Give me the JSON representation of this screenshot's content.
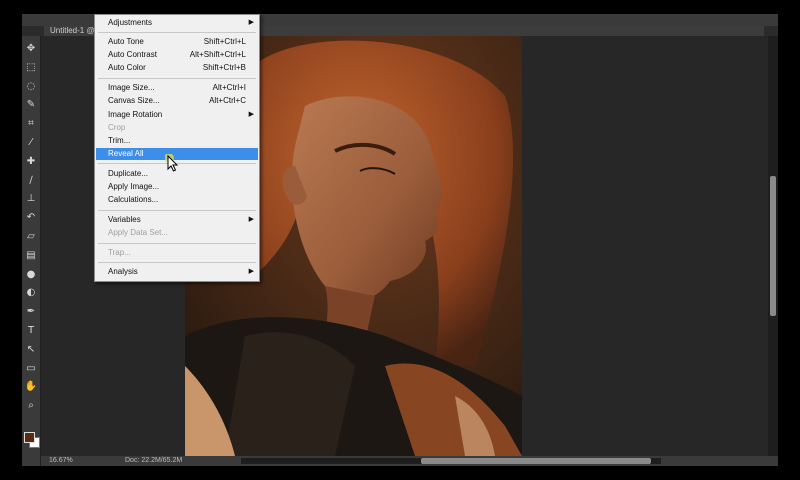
{
  "document": {
    "tab_label": "Untitled-1 @"
  },
  "status": {
    "zoom": "16.67%",
    "doc": "Doc: 22.2M/65.2M"
  },
  "colors": {
    "foreground": "#5a2a16",
    "background": "#ffffff",
    "menu_highlight": "#3d8ee8"
  },
  "tools": [
    {
      "name": "move-tool-icon",
      "glyph": "✥"
    },
    {
      "name": "marquee-tool-icon",
      "glyph": "⬚"
    },
    {
      "name": "lasso-tool-icon",
      "glyph": "◌"
    },
    {
      "name": "quick-select-tool-icon",
      "glyph": "✎"
    },
    {
      "name": "crop-tool-icon",
      "glyph": "⌗"
    },
    {
      "name": "eyedropper-tool-icon",
      "glyph": "⁄"
    },
    {
      "name": "healing-brush-tool-icon",
      "glyph": "✚"
    },
    {
      "name": "brush-tool-icon",
      "glyph": "∕"
    },
    {
      "name": "clone-stamp-tool-icon",
      "glyph": "⊥"
    },
    {
      "name": "history-brush-tool-icon",
      "glyph": "↶"
    },
    {
      "name": "eraser-tool-icon",
      "glyph": "▱"
    },
    {
      "name": "gradient-tool-icon",
      "glyph": "▤"
    },
    {
      "name": "blur-tool-icon",
      "glyph": "●"
    },
    {
      "name": "dodge-tool-icon",
      "glyph": "◐"
    },
    {
      "name": "pen-tool-icon",
      "glyph": "✒"
    },
    {
      "name": "type-tool-icon",
      "glyph": "T"
    },
    {
      "name": "path-select-tool-icon",
      "glyph": "↖"
    },
    {
      "name": "shape-tool-icon",
      "glyph": "▭"
    },
    {
      "name": "hand-tool-icon",
      "glyph": "✋"
    },
    {
      "name": "zoom-tool-icon",
      "glyph": "⌕"
    }
  ],
  "menu": {
    "adjustments": "Adjustments",
    "auto_tone": "Auto Tone",
    "auto_tone_sc": "Shift+Ctrl+L",
    "auto_contrast": "Auto Contrast",
    "auto_contrast_sc": "Alt+Shift+Ctrl+L",
    "auto_color": "Auto Color",
    "auto_color_sc": "Shift+Ctrl+B",
    "image_size": "Image Size...",
    "image_size_sc": "Alt+Ctrl+I",
    "canvas_size": "Canvas Size...",
    "canvas_size_sc": "Alt+Ctrl+C",
    "image_rotation": "Image Rotation",
    "crop": "Crop",
    "trim": "Trim...",
    "reveal_all": "Reveal All",
    "duplicate": "Duplicate...",
    "apply_image": "Apply Image...",
    "calculations": "Calculations...",
    "variables": "Variables",
    "apply_data_set": "Apply Data Set...",
    "trap": "Trap...",
    "analysis": "Analysis"
  }
}
